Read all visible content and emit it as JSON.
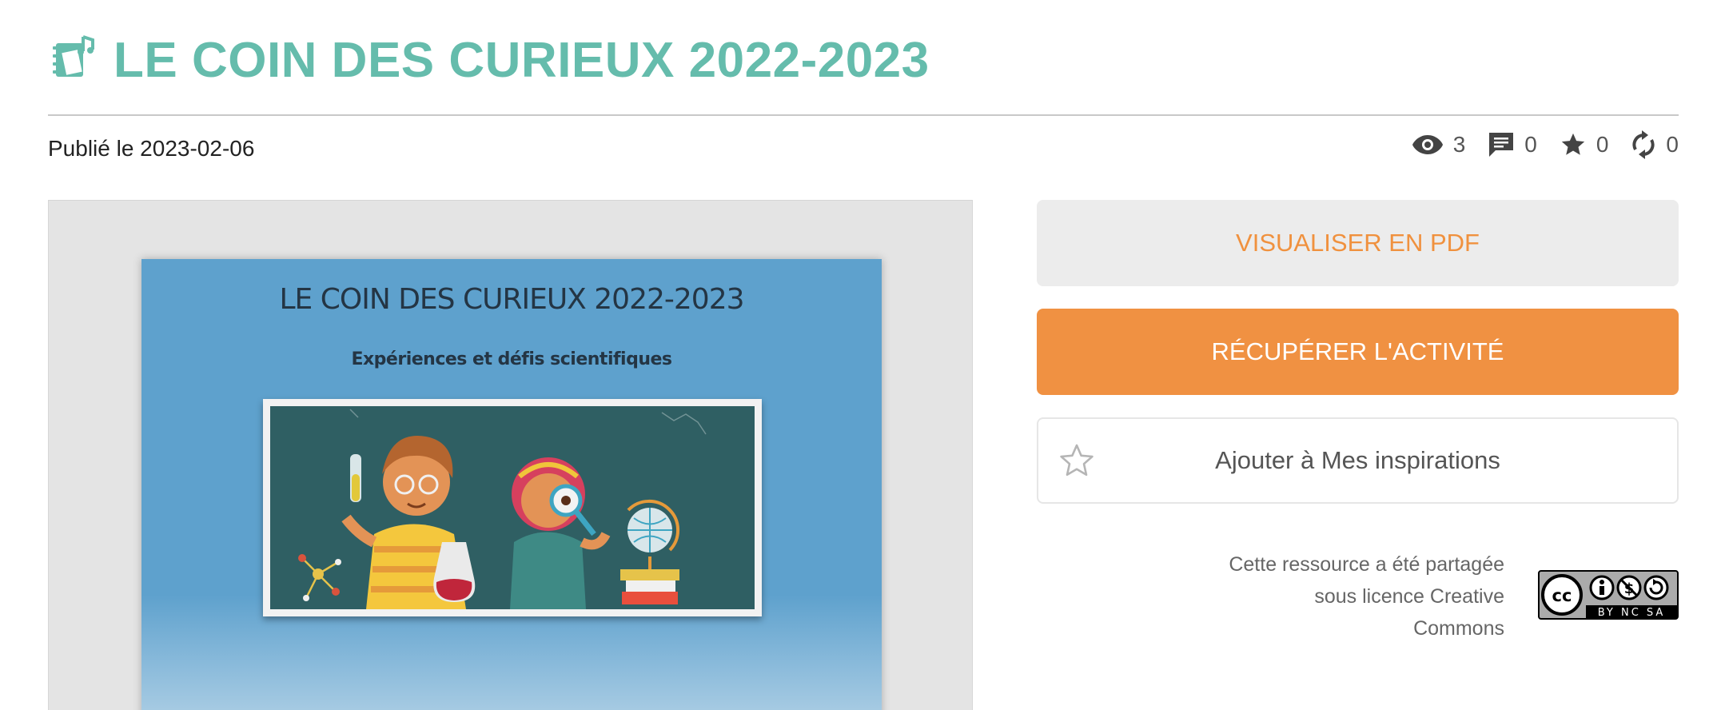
{
  "page": {
    "title": "LE COIN DES CURIEUX 2022-2023",
    "title_icon": "music-notebook-icon",
    "published_label": "Publié le 2023-02-06"
  },
  "stats": [
    {
      "icon": "eye-icon",
      "value": "3"
    },
    {
      "icon": "comment-icon",
      "value": "0"
    },
    {
      "icon": "star-icon",
      "value": "0"
    },
    {
      "icon": "refresh-icon",
      "value": "0"
    }
  ],
  "preview": {
    "cover_title": "LE COIN DES CURIEUX 2022-2023",
    "cover_subtitle": "Expériences et défis scientifiques"
  },
  "actions": {
    "pdf_label": "VISUALISER EN PDF",
    "get_label": "RÉCUPÉRER L'ACTIVITÉ",
    "inspiration_label": "Ajouter à Mes inspirations"
  },
  "license": {
    "line1": "Cette ressource a été partagée",
    "line2": "sous licence Creative",
    "line3": "Commons",
    "badge_icon": "cc-by-nc-sa-icon",
    "badge_text": "BY NC SA"
  },
  "colors": {
    "title": "#65bcac",
    "accent": "#f09142",
    "pdf_text": "#f0913e"
  }
}
